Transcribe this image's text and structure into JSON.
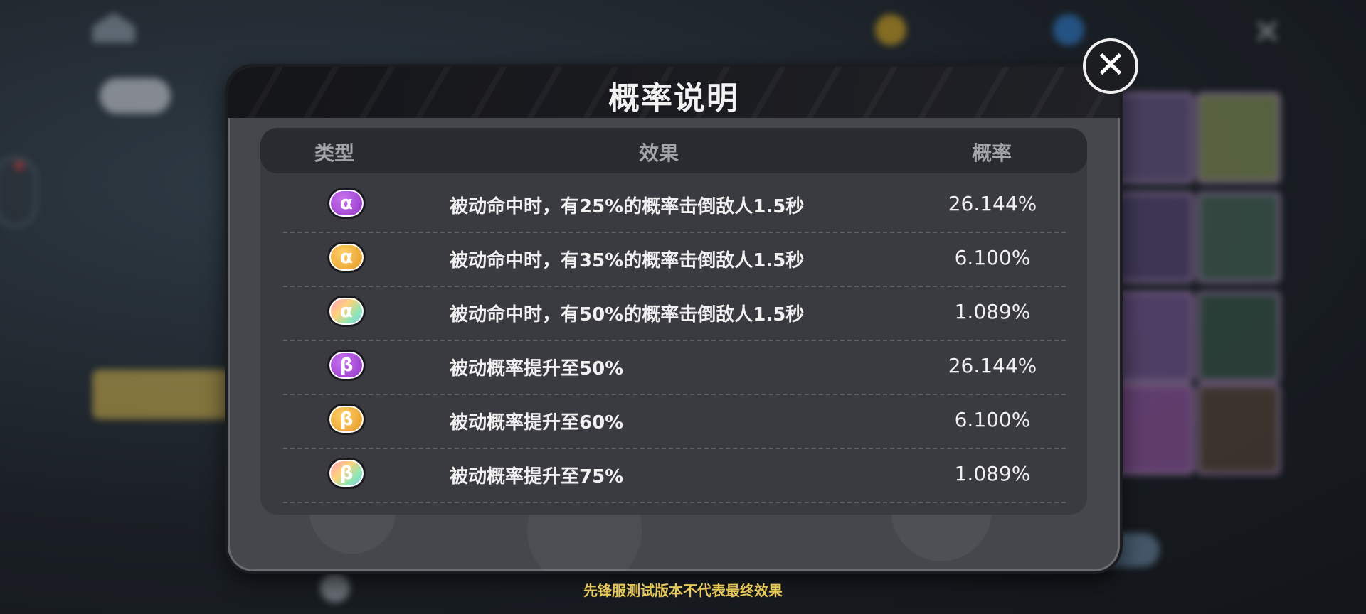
{
  "modal": {
    "title": "概率说明",
    "close_icon": "close-x-icon",
    "columns": {
      "type": "类型",
      "effect": "效果",
      "probability": "概率"
    },
    "rows": [
      {
        "badge_symbol": "α",
        "badge_style": "purple",
        "effect": "被动命中时，有25%的概率击倒敌人1.5秒",
        "probability": "26.144%"
      },
      {
        "badge_symbol": "α",
        "badge_style": "gold",
        "effect": "被动命中时，有35%的概率击倒敌人1.5秒",
        "probability": "6.100%"
      },
      {
        "badge_symbol": "α",
        "badge_style": "rainbow",
        "effect": "被动命中时，有50%的概率击倒敌人1.5秒",
        "probability": "1.089%"
      },
      {
        "badge_symbol": "β",
        "badge_style": "purple",
        "effect": "被动概率提升至50%",
        "probability": "26.144%"
      },
      {
        "badge_symbol": "β",
        "badge_style": "gold",
        "effect": "被动概率提升至60%",
        "probability": "6.100%"
      },
      {
        "badge_symbol": "β",
        "badge_style": "rainbow",
        "effect": "被动概率提升至75%",
        "probability": "1.089%"
      }
    ]
  },
  "footer": {
    "note": "先锋服测试版本不代表最终效果"
  },
  "colors": {
    "accent_gold": "#e6c75c",
    "modal_bg": "#46474d",
    "badge_purple": "#a447d9",
    "badge_gold": "#f0a936"
  }
}
